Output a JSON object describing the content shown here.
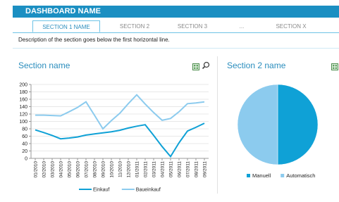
{
  "header": {
    "title": "DASHBOARD NAME"
  },
  "tabs": [
    {
      "label": "SECTION 1 NAME",
      "active": true
    },
    {
      "label": "SECTION 2",
      "active": false
    },
    {
      "label": "SECTION 3",
      "active": false
    },
    {
      "label": "...",
      "active": false
    },
    {
      "label": "SECTION X",
      "active": false
    }
  ],
  "description": "Description of the section goes below the first horizontal line.",
  "section1": {
    "title": "Section name",
    "icons": [
      "excel-export-icon",
      "search-icon"
    ]
  },
  "section2": {
    "title": "Section 2 name",
    "icons": [
      "excel-export-icon"
    ]
  },
  "colors": {
    "accent": "#1b8fc2",
    "series_dark": "#0fa1d6",
    "series_light": "#8ccbee"
  },
  "chart_data": [
    {
      "type": "line",
      "categories": [
        "01/2010",
        "02/2010",
        "03/2010",
        "04/2010",
        "05/2010",
        "06/2010",
        "07/2010",
        "08/2010",
        "09/2010",
        "10/2010",
        "11/2010",
        "12/2010",
        "01/2011",
        "02/2011",
        "03/2011",
        "04/2011",
        "05/2011",
        "06/2011",
        "07/2011",
        "08/2011",
        "09/2011"
      ],
      "yticks": [
        0,
        20,
        40,
        60,
        80,
        100,
        120,
        140,
        160,
        180,
        200
      ],
      "ylim": [
        0,
        200
      ],
      "series": [
        {
          "name": "Einkauf",
          "color": "#0fa1d6",
          "values": [
            77,
            70,
            62,
            53,
            55,
            58,
            63,
            66,
            69,
            72,
            76,
            82,
            87,
            91,
            62,
            32,
            5,
            42,
            74,
            84,
            95
          ]
        },
        {
          "name": "Baueinkauf",
          "color": "#8ccbee",
          "values": [
            117,
            117,
            116,
            115,
            126,
            138,
            153,
            117,
            80,
            102,
            122,
            148,
            172,
            147,
            124,
            103,
            108,
            126,
            148,
            150,
            153
          ]
        }
      ],
      "legend": "bottom"
    },
    {
      "type": "pie",
      "labels": [
        "Manuell",
        "Automatisch"
      ],
      "values": [
        50,
        50
      ],
      "colors": [
        "#0fa1d6",
        "#8ccbee"
      ],
      "legend": "bottom"
    }
  ]
}
